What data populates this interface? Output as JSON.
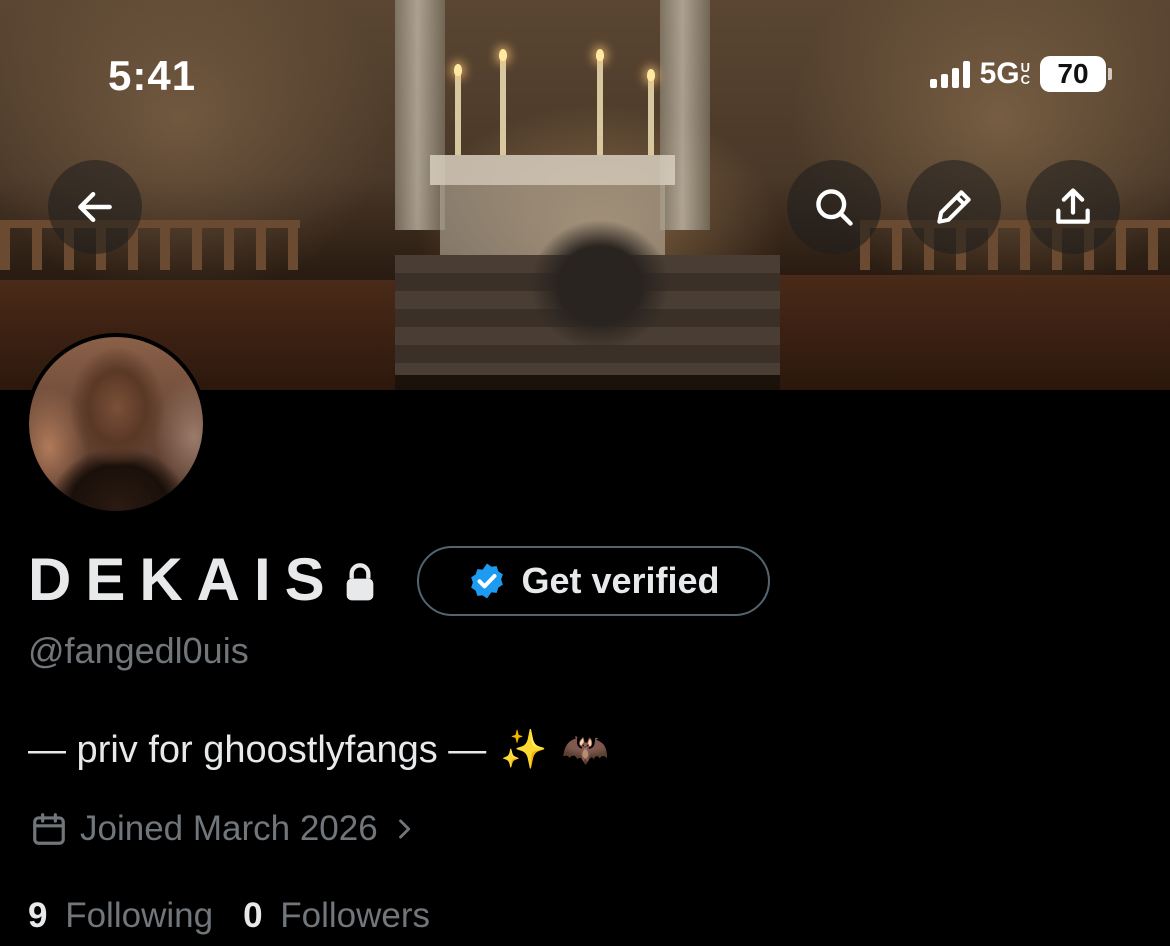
{
  "status_bar": {
    "time": "5:41",
    "network": "5G",
    "network_suffix_top": "U",
    "network_suffix_bottom": "C",
    "battery": "70"
  },
  "header_buttons": {
    "back": "arrow-left-icon",
    "search": "search-icon",
    "edit": "pencil-icon",
    "share": "share-icon"
  },
  "profile": {
    "display_name": "DEKAIS",
    "handle": "@fangedl0uis",
    "protected_icon": "lock-icon",
    "get_verified_label": "Get verified",
    "bio_text": "— priv for ghoostlyfangs —",
    "bio_emoji_1": "✨",
    "bio_emoji_2": "🦇",
    "joined_text": "Joined March 2026",
    "following_count": "9",
    "following_label": "Following",
    "followers_count": "0",
    "followers_label": "Followers"
  },
  "colors": {
    "background": "#000000",
    "primary_text": "#e7e9ea",
    "secondary_text": "#71767b",
    "verified_blue": "#1d9bf0",
    "border": "#536471"
  }
}
